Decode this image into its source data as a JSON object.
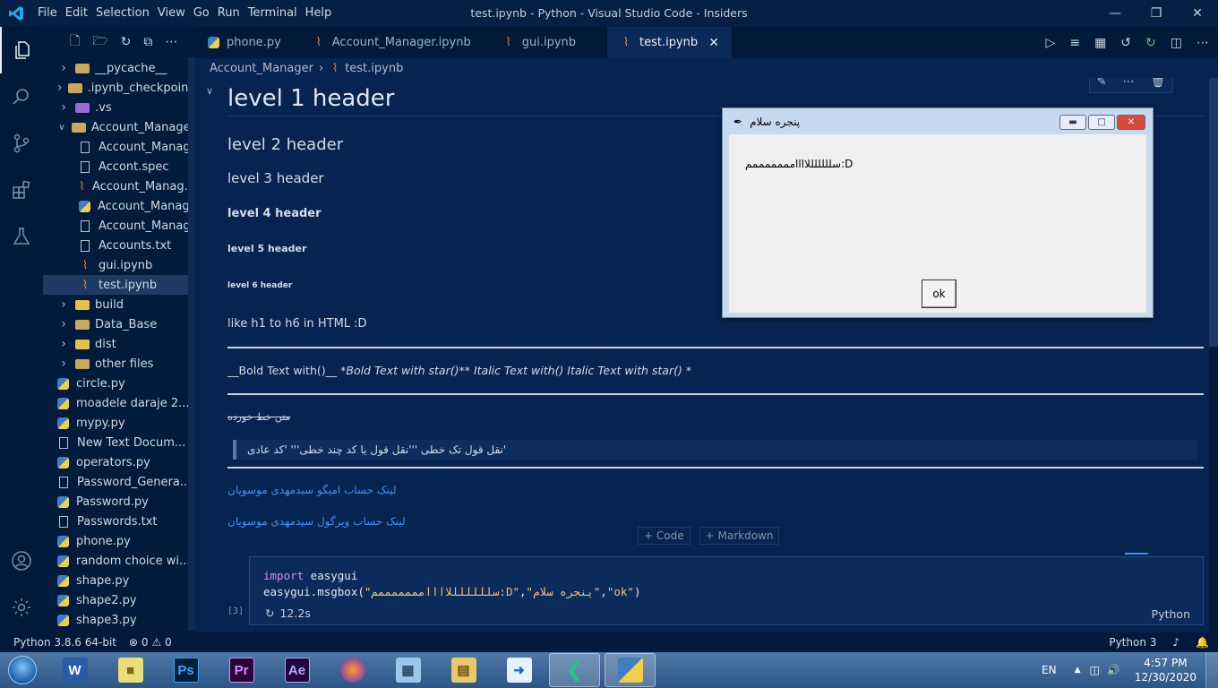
{
  "window": {
    "title": "test.ipynb - Python - Visual Studio Code - Insiders",
    "menu": [
      "File",
      "Edit",
      "Selection",
      "View",
      "Go",
      "Run",
      "Terminal",
      "Help"
    ]
  },
  "tabs": [
    {
      "label": "phone.py",
      "icon": "python-icon"
    },
    {
      "label": "Account_Manager.ipynb",
      "icon": "notebook-icon"
    },
    {
      "label": "gui.ipynb",
      "icon": "notebook-icon"
    },
    {
      "label": "test.ipynb",
      "icon": "notebook-icon",
      "active": true
    }
  ],
  "breadcrumb": {
    "folder": "Account_Manager",
    "file": "test.ipynb"
  },
  "explorer": {
    "items": [
      {
        "label": "__pycache__",
        "type": "folder",
        "depth": 1,
        "expanded": false
      },
      {
        "label": ".ipynb_checkpoints",
        "type": "folder",
        "depth": 1,
        "expanded": false
      },
      {
        "label": ".vs",
        "type": "folder-vs",
        "depth": 1,
        "expanded": false
      },
      {
        "label": "Account_Manager",
        "type": "folder",
        "depth": 1,
        "expanded": true
      },
      {
        "label": "Account_Manager...",
        "type": "file",
        "depth": 2
      },
      {
        "label": "Accont.spec",
        "type": "file",
        "depth": 2
      },
      {
        "label": "Account_Manag...",
        "type": "notebook",
        "depth": 2
      },
      {
        "label": "Account_Manag...",
        "type": "python",
        "depth": 2
      },
      {
        "label": "Account_Manag...",
        "type": "file",
        "depth": 2
      },
      {
        "label": "Accounts.txt",
        "type": "text",
        "depth": 2
      },
      {
        "label": "gui.ipynb",
        "type": "notebook",
        "depth": 2
      },
      {
        "label": "test.ipynb",
        "type": "notebook",
        "depth": 2,
        "selected": true
      },
      {
        "label": "build",
        "type": "folder-yellow",
        "depth": 1,
        "expanded": false
      },
      {
        "label": "Data_Base",
        "type": "folder",
        "depth": 1,
        "expanded": false
      },
      {
        "label": "dist",
        "type": "folder-yellow",
        "depth": 1,
        "expanded": false
      },
      {
        "label": "other files",
        "type": "folder",
        "depth": 1,
        "expanded": false
      },
      {
        "label": "circle.py",
        "type": "python",
        "depth": 1
      },
      {
        "label": "moadele daraje 2....",
        "type": "python",
        "depth": 1
      },
      {
        "label": "mypy.py",
        "type": "python",
        "depth": 1
      },
      {
        "label": "New Text Docum...",
        "type": "text",
        "depth": 1
      },
      {
        "label": "operators.py",
        "type": "python",
        "depth": 1
      },
      {
        "label": "Password_Genera...",
        "type": "file",
        "depth": 1
      },
      {
        "label": "Password.py",
        "type": "python",
        "depth": 1
      },
      {
        "label": "Passwords.txt",
        "type": "text",
        "depth": 1
      },
      {
        "label": "phone.py",
        "type": "python",
        "depth": 1
      },
      {
        "label": "random choice wi...",
        "type": "python",
        "depth": 1
      },
      {
        "label": "shape.py",
        "type": "python",
        "depth": 1
      },
      {
        "label": "shape2.py",
        "type": "python",
        "depth": 1
      },
      {
        "label": "shape3.py",
        "type": "python",
        "depth": 1
      }
    ]
  },
  "markdown": {
    "h1": "level 1 header",
    "h2": "level 2 header",
    "h3": "level 3 header",
    "h4": "level 4 header",
    "h5": "level 5 header",
    "h6": "level 6 header",
    "para": "like h1 to h6 in HTML :D",
    "emphasis_plain": "__Bold Text with()__",
    "emphasis_italic": " *Bold Text with star()** Italic Text with() Italic Text with star() *",
    "strike": "متن خط خورده",
    "quote": "نقل قول تک خطی '''نقل قول یا کد چند خطی''' 'کد عادی'",
    "link1": "لینک حساب امیگو سیدمهدی موسویان",
    "link2": "لینک حساب ویرگول سیدمهدی موسویان"
  },
  "add_buttons": {
    "code": "Code",
    "markdown": "Markdown"
  },
  "code_cell": {
    "line1_kw": "import",
    "line1_rest": " easygui",
    "line2_fn": "easygui.msgbox(",
    "line2_arg1": "\"سلللللللاااامممممممم:D\"",
    "line2_arg2": "\"پنجره سلام\"",
    "line2_arg3": "\"ok\"",
    "line2_end": ")",
    "exec_count": "[3]",
    "duration": "12.2s",
    "language": "Python"
  },
  "dialog": {
    "title": "پنجره سلام",
    "message": "سلللللللاااامممممممم:D",
    "ok": "ok"
  },
  "statusbar": {
    "interpreter": "Python 3.8.6 64-bit",
    "errors": "0",
    "warnings": "0",
    "kernel": "Python 3"
  },
  "taskbar": {
    "lang": "EN",
    "time": "4:57 PM",
    "date": "12/30/2020"
  },
  "colors": {
    "accent": "#3794ff",
    "editor_bg": "#062450",
    "sidebar_bg": "#011b3d"
  }
}
